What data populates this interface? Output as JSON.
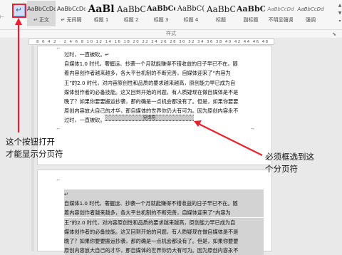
{
  "ribbon": {
    "show_marks_button_glyph": "↵",
    "styles": [
      {
        "sample": "AaBbCcDd",
        "name": "↵ 正文",
        "size": 8,
        "weight": "normal",
        "italic": false,
        "color": "#333333",
        "active": true
      },
      {
        "sample": "AaBbCcDd",
        "name": "↵ 无间隔",
        "size": 8,
        "weight": "normal",
        "italic": false,
        "color": "#333333",
        "active": false
      },
      {
        "sample": "AaBl",
        "name": "标题 1",
        "size": 14,
        "weight": "bold",
        "italic": false,
        "color": "#111111",
        "active": false
      },
      {
        "sample": "AaBbC",
        "name": "标题 2",
        "size": 12,
        "weight": "normal",
        "italic": false,
        "color": "#222222",
        "active": false
      },
      {
        "sample": "AaBbCc",
        "name": "标题 3",
        "size": 10,
        "weight": "bold",
        "italic": false,
        "color": "#222222",
        "active": false
      },
      {
        "sample": "AaBbC(",
        "name": "标题 4",
        "size": 10,
        "weight": "normal",
        "italic": false,
        "color": "#222222",
        "active": false
      },
      {
        "sample": "AaBbC",
        "name": "标题",
        "size": 12,
        "weight": "normal",
        "italic": false,
        "color": "#222222",
        "active": false
      },
      {
        "sample": "AaBbC",
        "name": "副标题",
        "size": 11,
        "weight": "bold",
        "italic": false,
        "color": "#222222",
        "active": false
      },
      {
        "sample": "AaBbCcDd",
        "name": "不明显强调",
        "size": 7,
        "weight": "normal",
        "italic": true,
        "color": "#777777",
        "active": false
      },
      {
        "sample": "AaBbCcDd",
        "name": "强调",
        "size": 7,
        "weight": "normal",
        "italic": true,
        "color": "#555555",
        "active": false
      }
    ],
    "group_label": "样式",
    "launcher_glyph": "⬊",
    "scroll_glyphs": [
      "▲",
      "▼",
      "▾"
    ]
  },
  "ruler": {
    "ticks": "8 6 4 2 · 2 4 6 8 10 12 14 16 18 20 22 24 26 28 30 32 34 36 38 40 42 44 46 48"
  },
  "page1": {
    "lines": [
      "过时，一直被砍。↵",
      "自媒体1.0 时代，奢握运、抄袭一个月就能赚得不错收益的日子早已不在。随",
      "着内容创作者越来越多，各大平台机制的不断完善，自媒体迎来了“内容为",
      "王”的2.0 时代，对内容原创性和品质的要求越来越高，原创能力早已成为自",
      "媒体创作者的必备技能。这又回到开始的问题，有人质疑现在做自媒体是不是",
      "晚了？如果你要要搬运抄袭，那的确是一点机会都没有了。但是，如果你要要",
      "原创内容放大自己的才华，那自媒体的世界你仍大有可为。因为原创内容永不",
      "过时，一直被砍。"
    ],
    "page_break_label": "分页符"
  },
  "page2": {
    "lines": [
      "↵",
      "自媒体1.0 时代，奢握运、抄袭一个月就能赚得不错收益的日子早已不在。随",
      "着内容创作者越来越多，各大平台机制的不断完善，自媒体迎来了“内容为",
      "王”的2.0 时代，对内容原创性和品质的要求越来越高，原创能力早已成为自",
      "媒体创作者的必备技能。这又回到开始的问题，有人质疑现在做自媒体是不是",
      "晚了？如果你要要搬运抄袭，那的确是一点机会都没有了。但是，如果你要要",
      "原创内容放大自己的才华，那自媒体的世界你仍大有可为。因为原创内容永不"
    ]
  },
  "annotations": {
    "left_line1": "这个按钮打开",
    "left_line2": "才能显示分页符",
    "right_line1": "必须框选到这",
    "right_line2": "个分页符"
  },
  "colors": {
    "annotation_red": "#e8232d"
  }
}
